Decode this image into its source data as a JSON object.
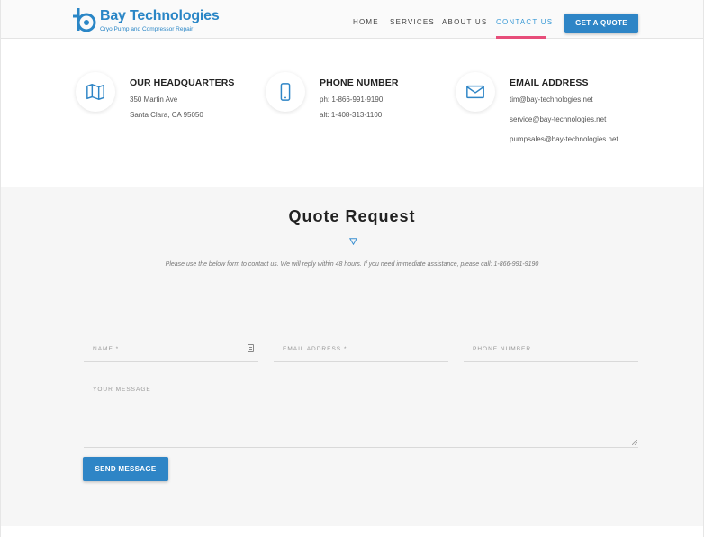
{
  "brand": {
    "name": "Bay Technologies",
    "tagline": "Cryo Pump and Compressor Repair",
    "color": "#2a86c6"
  },
  "nav": {
    "items": [
      {
        "label": "HOME",
        "active": false
      },
      {
        "label": "SERVICES",
        "active": false
      },
      {
        "label": "ABOUT US",
        "active": false
      },
      {
        "label": "CONTACT US",
        "active": true
      }
    ],
    "cta_label": "GET A QUOTE",
    "active_underline_color": "#e74e7a"
  },
  "contact": {
    "headquarters": {
      "icon": "map-icon",
      "title": "OUR HEADQUARTERS",
      "lines": [
        "350 Martin Ave",
        "Santa Clara, CA 95050"
      ]
    },
    "phone": {
      "icon": "phone-icon",
      "title": "PHONE NUMBER",
      "lines": [
        "ph: 1-866-991-9190",
        "alt: 1-408-313-1100"
      ]
    },
    "email": {
      "icon": "envelope-icon",
      "title": "EMAIL ADDRESS",
      "lines": [
        "tim@bay-technologies.net",
        "service@bay-technologies.net",
        "pumpsales@bay-technologies.net"
      ]
    }
  },
  "quote": {
    "title": "Quote Request",
    "description": "Please use the below form to contact us. We will reply within 48 hours. If you need immediate assistance, please call: 1-866-991-9190",
    "fields": {
      "name_placeholder": "NAME *",
      "email_placeholder": "EMAIL ADDRESS *",
      "phone_placeholder": "PHONE NUMBER",
      "message_placeholder": "YOUR MESSAGE"
    },
    "submit_label": "SEND MESSAGE"
  }
}
